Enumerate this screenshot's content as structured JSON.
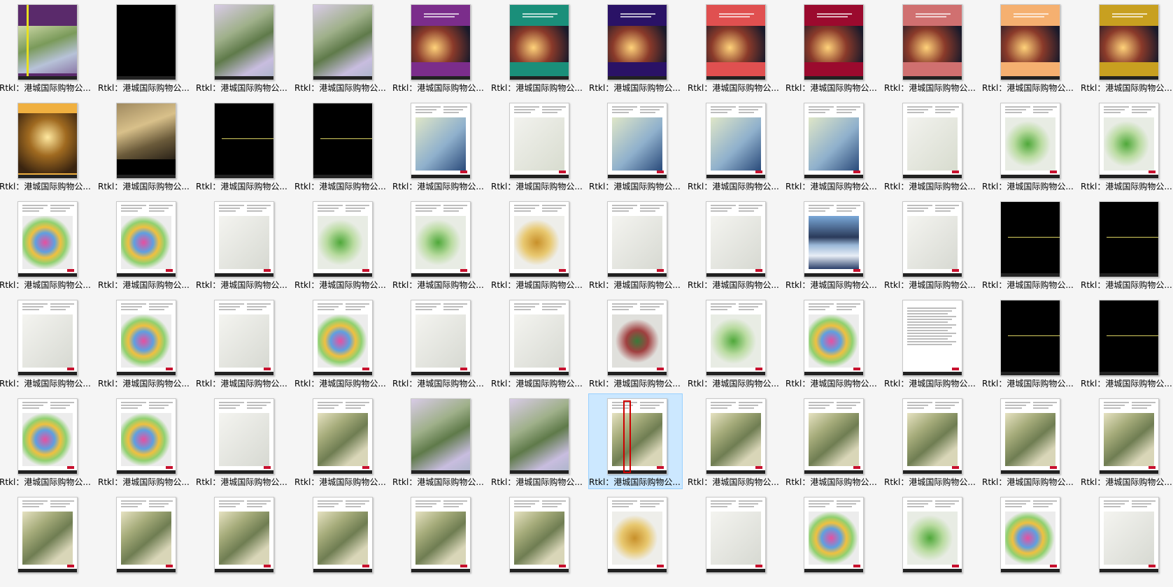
{
  "folder_view": {
    "selected_index": 54,
    "items": [
      {
        "label": "Rtkl：港城国际购物公...",
        "style": "cover",
        "bg": "#5a2a6b"
      },
      {
        "label": "Rtkl：港城国际购物公...",
        "style": "black",
        "bg": "#000000"
      },
      {
        "label": "Rtkl：港城国际购物公...",
        "style": "aerial",
        "bg": "#9c8fb8"
      },
      {
        "label": "Rtkl：港城国际购物公...",
        "style": "aerial",
        "bg": "#8ea07a"
      },
      {
        "label": "Rtkl：港城国际购物公...",
        "style": "cover-photo",
        "bg": "#7b2d8b"
      },
      {
        "label": "Rtkl：港城国际购物公...",
        "style": "cover-photo",
        "bg": "#1a8f7a"
      },
      {
        "label": "Rtkl：港城国际购物公...",
        "style": "cover-photo",
        "bg": "#2a1266"
      },
      {
        "label": "Rtkl：港城国际购物公...",
        "style": "cover-photo",
        "bg": "#e05050"
      },
      {
        "label": "Rtkl：港城国际购物公...",
        "style": "cover-photo",
        "bg": "#9b0a2e"
      },
      {
        "label": "Rtkl：港城国际购物公...",
        "style": "cover-photo",
        "bg": "#d07070"
      },
      {
        "label": "Rtkl：港城国际购物公...",
        "style": "cover-photo",
        "bg": "#f5b070"
      },
      {
        "label": "Rtkl：港城国际购物公...",
        "style": "cover-photo",
        "bg": "#c8a020"
      },
      {
        "label": "Rtkl：港城国际购物公...",
        "style": "photo",
        "bg": "#f0b040"
      },
      {
        "label": "Rtkl：港城国际购物公...",
        "style": "photo-dark",
        "bg": "#000000"
      },
      {
        "label": "Rtkl：港城国际购物公...",
        "style": "divider",
        "bg": "#000000"
      },
      {
        "label": "Rtkl：港城国际购物公...",
        "style": "divider",
        "bg": "#000000"
      },
      {
        "label": "Rtkl：港城国际购物公...",
        "style": "map",
        "bg": "#ffffff"
      },
      {
        "label": "Rtkl：港城国际购物公...",
        "style": "map-light",
        "bg": "#ffffff"
      },
      {
        "label": "Rtkl：港城国际购物公...",
        "style": "map",
        "bg": "#ffffff"
      },
      {
        "label": "Rtkl：港城国际购物公...",
        "style": "map",
        "bg": "#ffffff"
      },
      {
        "label": "Rtkl：港城国际购物公...",
        "style": "map",
        "bg": "#ffffff"
      },
      {
        "label": "Rtkl：港城国际购物公...",
        "style": "map-light",
        "bg": "#ffffff"
      },
      {
        "label": "Rtkl：港城国际购物公...",
        "style": "plan-green",
        "bg": "#ffffff"
      },
      {
        "label": "Rtkl：港城国际购物公...",
        "style": "plan-green",
        "bg": "#ffffff"
      },
      {
        "label": "Rtkl：港城国际购物公...",
        "style": "plan-color",
        "bg": "#ffffff"
      },
      {
        "label": "Rtkl：港城国际购物公...",
        "style": "plan-color",
        "bg": "#ffffff"
      },
      {
        "label": "Rtkl：港城国际购物公...",
        "style": "plan-lines",
        "bg": "#ffffff"
      },
      {
        "label": "Rtkl：港城国际购物公...",
        "style": "plan-green",
        "bg": "#ffffff"
      },
      {
        "label": "Rtkl：港城国际购物公...",
        "style": "plan-green",
        "bg": "#ffffff"
      },
      {
        "label": "Rtkl：港城国际购物公...",
        "style": "plan-yellow",
        "bg": "#ffffff"
      },
      {
        "label": "Rtkl：港城国际购物公...",
        "style": "plan-lines",
        "bg": "#ffffff"
      },
      {
        "label": "Rtkl：港城国际购物公...",
        "style": "plan-lines",
        "bg": "#ffffff"
      },
      {
        "label": "Rtkl：港城国际购物公...",
        "style": "photo-sky",
        "bg": "#ffffff"
      },
      {
        "label": "Rtkl：港城国际购物公...",
        "style": "plan-lines",
        "bg": "#ffffff"
      },
      {
        "label": "Rtkl：港城国际购物公...",
        "style": "divider",
        "bg": "#000000"
      },
      {
        "label": "Rtkl：港城国际购物公...",
        "style": "divider",
        "bg": "#000000"
      },
      {
        "label": "Rtkl：港城国际购物公...",
        "style": "plan-lines",
        "bg": "#ffffff"
      },
      {
        "label": "Rtkl：港城国际购物公...",
        "style": "plan-color",
        "bg": "#ffffff"
      },
      {
        "label": "Rtkl：港城国际购物公...",
        "style": "plan-lines",
        "bg": "#ffffff"
      },
      {
        "label": "Rtkl：港城国际购物公...",
        "style": "plan-color",
        "bg": "#ffffff"
      },
      {
        "label": "Rtkl：港城国际购物公...",
        "style": "plan-lines",
        "bg": "#ffffff"
      },
      {
        "label": "Rtkl：港城国际购物公...",
        "style": "plan-lines",
        "bg": "#ffffff"
      },
      {
        "label": "Rtkl：港城国际购物公...",
        "style": "plan-dark",
        "bg": "#ffffff"
      },
      {
        "label": "Rtkl：港城国际购物公...",
        "style": "plan-green",
        "bg": "#ffffff"
      },
      {
        "label": "Rtkl：港城国际购物公...",
        "style": "plan-color",
        "bg": "#ffffff"
      },
      {
        "label": "Rtkl：港城国际购物公...",
        "style": "text",
        "bg": "#ffffff"
      },
      {
        "label": "Rtkl：港城国际购物公...",
        "style": "divider",
        "bg": "#000000"
      },
      {
        "label": "Rtkl：港城国际购物公...",
        "style": "divider",
        "bg": "#000000"
      },
      {
        "label": "Rtkl：港城国际购物公...",
        "style": "plan-color",
        "bg": "#ffffff"
      },
      {
        "label": "Rtkl：港城国际购物公...",
        "style": "plan-color",
        "bg": "#ffffff"
      },
      {
        "label": "Rtkl：港城国际购物公...",
        "style": "plan-lines",
        "bg": "#ffffff"
      },
      {
        "label": "Rtkl：港城国际购物公...",
        "style": "render",
        "bg": "#ffffff"
      },
      {
        "label": "Rtkl：港城国际购物公...",
        "style": "aerial",
        "bg": "#9c8fb8"
      },
      {
        "label": "Rtkl：港城国际购物公...",
        "style": "aerial",
        "bg": "#8ea07a"
      },
      {
        "label": "Rtkl：港城国际购物公...",
        "style": "render",
        "bg": "#ffffff"
      },
      {
        "label": "Rtkl：港城国际购物公...",
        "style": "render",
        "bg": "#ffffff"
      },
      {
        "label": "Rtkl：港城国际购物公...",
        "style": "render",
        "bg": "#ffffff"
      },
      {
        "label": "Rtkl：港城国际购物公...",
        "style": "render",
        "bg": "#ffffff"
      },
      {
        "label": "Rtkl：港城国际购物公...",
        "style": "render",
        "bg": "#ffffff"
      },
      {
        "label": "Rtkl：港城国际购物公...",
        "style": "render",
        "bg": "#ffffff"
      },
      {
        "label": "",
        "style": "render",
        "bg": "#ffffff"
      },
      {
        "label": "",
        "style": "render",
        "bg": "#ffffff"
      },
      {
        "label": "",
        "style": "render",
        "bg": "#ffffff"
      },
      {
        "label": "",
        "style": "render",
        "bg": "#ffffff"
      },
      {
        "label": "",
        "style": "render",
        "bg": "#ffffff"
      },
      {
        "label": "",
        "style": "render",
        "bg": "#ffffff"
      },
      {
        "label": "",
        "style": "plan-yellow",
        "bg": "#ffffff"
      },
      {
        "label": "",
        "style": "plan-lines",
        "bg": "#ffffff"
      },
      {
        "label": "",
        "style": "plan-color",
        "bg": "#ffffff"
      },
      {
        "label": "",
        "style": "plan-green",
        "bg": "#ffffff"
      },
      {
        "label": "",
        "style": "plan-color",
        "bg": "#ffffff"
      },
      {
        "label": "",
        "style": "plan-lines",
        "bg": "#ffffff"
      }
    ]
  }
}
